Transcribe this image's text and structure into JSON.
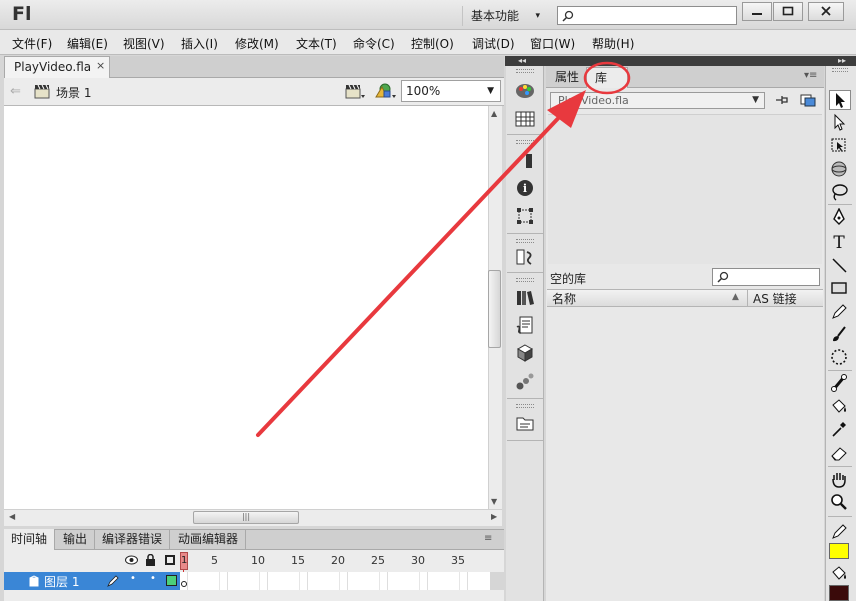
{
  "app": {
    "logo": "Fl",
    "workspace": "基本功能"
  },
  "menu": [
    "文件(F)",
    "编辑(E)",
    "视图(V)",
    "插入(I)",
    "修改(M)",
    "文本(T)",
    "命令(C)",
    "控制(O)",
    "调试(D)",
    "窗口(W)",
    "帮助(H)"
  ],
  "document": {
    "tab_label": "PlayVideo.fla",
    "close_glyph": "×"
  },
  "scene": {
    "label": "场景 1",
    "zoom": "100%"
  },
  "timeline": {
    "tabs": [
      "时间轴",
      "输出",
      "编译器错误",
      "动画编辑器"
    ],
    "frame_numbers": [
      "5",
      "10",
      "15",
      "20",
      "25",
      "30",
      "35"
    ],
    "current_frame": "1",
    "layer_name": "图层 1"
  },
  "panel": {
    "tabs": {
      "properties": "属性",
      "library": "库"
    },
    "library_file": "PlayVideo.fla",
    "empty_label": "空的库",
    "col_name": "名称",
    "col_as": "AS 链接"
  },
  "colors": {
    "stroke": "#ffff00",
    "fill": "#3a0a0a",
    "annotation": "#e8393e"
  }
}
